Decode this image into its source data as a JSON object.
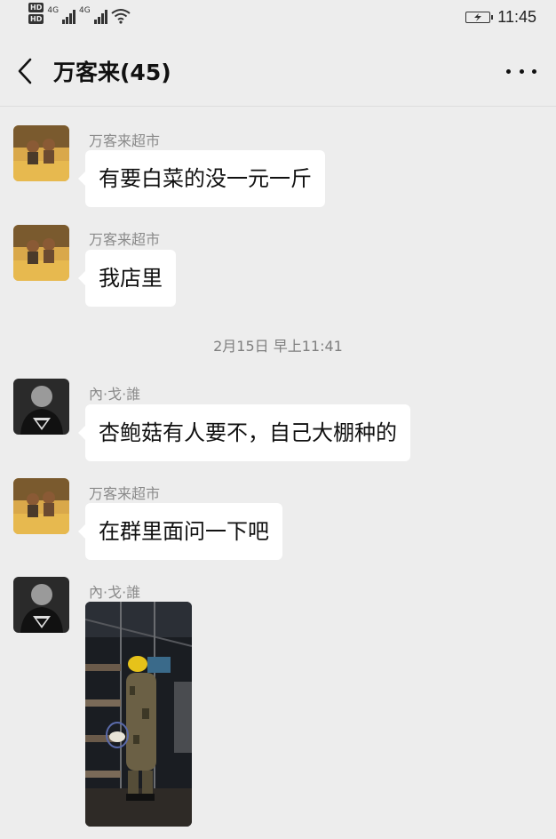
{
  "status_bar": {
    "hd1": "HD",
    "hd2": "HD",
    "sim1_tech": "4G",
    "sim2_tech": "4G",
    "time": "11:45"
  },
  "header": {
    "title": "万客来(45)"
  },
  "messages": [
    {
      "sender": "万客来超市",
      "text": "有要白菜的没一元一斤"
    },
    {
      "sender": "万客来超市",
      "text": "我店里"
    },
    {
      "sender": "內·戈·誰",
      "text": "杏鲍菇有人要不，自己大棚种的"
    },
    {
      "sender": "万客来超市",
      "text": "在群里面问一下吧"
    },
    {
      "sender": "內·戈·誰",
      "text": ""
    }
  ],
  "timestamp": "2月15日 早上11:41",
  "colors": {
    "background": "#ededed",
    "bubble": "#ffffff",
    "sender_text": "#8a8a8a"
  }
}
